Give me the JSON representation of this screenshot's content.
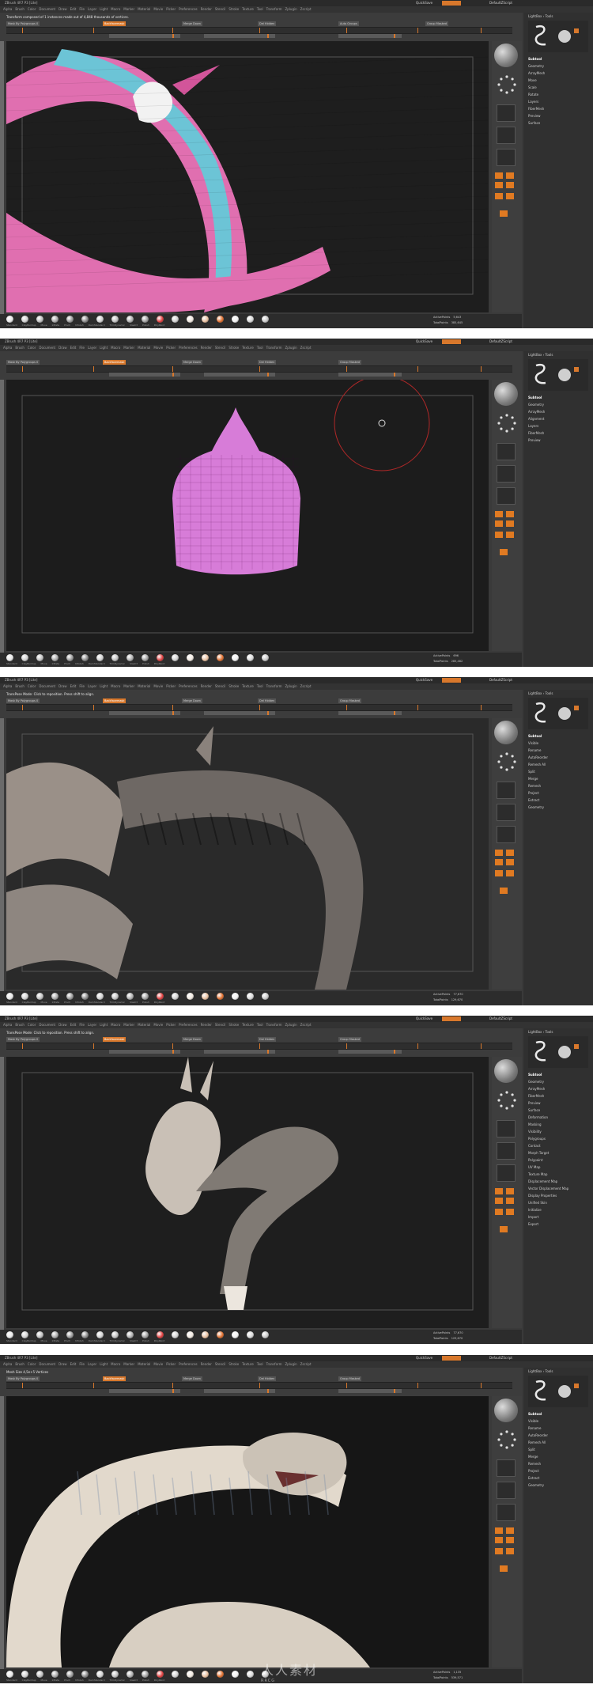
{
  "common": {
    "quicksave": "QuickSave",
    "menus": "Menus",
    "default_zscript": "DefaultZScript",
    "menubar": [
      "Alpha",
      "Brush",
      "Color",
      "Document",
      "Draw",
      "Edit",
      "File",
      "Layer",
      "Light",
      "Macro",
      "Marker",
      "Material",
      "Movie",
      "Picker",
      "Preferences",
      "Render",
      "Stencil",
      "Stroke",
      "Texture",
      "Tool",
      "Transform",
      "Zplugin",
      "Zscript"
    ],
    "active_points": "ActivePoints",
    "total_points": "TotalPoints",
    "brush_labels": [
      "Standard",
      "ClayBuildup",
      "Move",
      "Inflate",
      "Pinch",
      "hPolish",
      "DamStandard",
      "TrimDynamic",
      "Slash3",
      "Polish",
      "PolyPaint"
    ]
  },
  "panels": [
    {
      "title": "ZBrush 4R7 P3 [Lite]",
      "message": "Transform composed of 1 instances made out of 4,848 thousands of vertices.",
      "controls": [
        "Mask By Polygroups 0",
        "Auto Groups With UV",
        "Backfacemask",
        "Group Split",
        "Merge Down",
        "Split Masked Points",
        "Del Hidden",
        "Close Holes",
        "Auto Groups",
        "Front Shading",
        "Group Masked"
      ],
      "active_points": "5,643",
      "total_points": "385,645",
      "tray_items": [
        "Subtool",
        "Geometry",
        "ArrayMesh",
        "Move",
        "Scale",
        "Rotate",
        "Layers",
        "FiberMesh",
        "Preview",
        "Surface"
      ]
    },
    {
      "title": "ZBrush 4R7 P3 [Lite]",
      "message": "",
      "controls": [
        "Mask By Polygroups 0",
        "Auto Groups With UV",
        "Backfacemask",
        "Group Split",
        "Merge Down",
        "Split Masked Points",
        "Del Hidden",
        "Auto Groups",
        "Group Masked"
      ],
      "active_points": "696",
      "total_points": "285,482",
      "tray_items": [
        "Subtool",
        "Geometry",
        "ArrayMesh",
        "Alignment",
        "Layers",
        "FiberMesh",
        "Preview"
      ]
    },
    {
      "title": "ZBrush 4R7 P3 [Lite]",
      "message": "TransPose Mode: Click to reposition. Press shift to align.",
      "controls": [
        "Mask By Polygroups 0",
        "Auto Groups With UV",
        "Backfacemask",
        "Group Split",
        "Merge Down",
        "Split Masked Points",
        "Del Hidden",
        "Auto Groups",
        "Group Masked"
      ],
      "active_points": "77,670",
      "total_points": "129,670",
      "tray_items": [
        "Subtool",
        "Visible",
        "Rename",
        "AutoReorder",
        "Remesh All",
        "Split",
        "Merge",
        "Remesh",
        "Project",
        "Extract",
        "Geometry"
      ]
    },
    {
      "title": "ZBrush 4R7 P3 [Lite]",
      "message": "TransPose Mode: Click to reposition. Press shift to align.",
      "controls": [
        "Mask By Polygroups 0",
        "Auto Groups With UV",
        "Backfacemask",
        "Group Split",
        "Merge Down",
        "Split Masked Points",
        "Del Hidden",
        "Auto Groups",
        "Group Masked"
      ],
      "active_points": "77,670",
      "total_points": "129,670",
      "tray_items": [
        "Subtool",
        "Geometry",
        "ArrayMesh",
        "FiberMesh",
        "Preview",
        "Surface",
        "Deformation",
        "Masking",
        "Visibility",
        "Polygroups",
        "Contact",
        "Morph Target",
        "Polypaint",
        "UV Map",
        "Texture Map",
        "Displacement Map",
        "Vector Displacement Map",
        "Display Properties",
        "Unified Skin",
        "Initialize",
        "Import",
        "Export"
      ]
    },
    {
      "title": "ZBrush 4R7 P3 [Lite]",
      "message": "Mesh Size 4,5e+5 Vertices",
      "controls": [
        "Mask By Polygroups 0",
        "Auto Groups With UV",
        "Backfacemask",
        "Group Split",
        "Merge Down",
        "Split Masked Points",
        "Del Hidden",
        "Auto Groups",
        "Group Masked"
      ],
      "active_points": "1,135",
      "total_points": "539,571",
      "tray_items": [
        "Subtool",
        "Visible",
        "Rename",
        "AutoReorder",
        "Remesh All",
        "Split",
        "Merge",
        "Remesh",
        "Project",
        "Extract",
        "Geometry"
      ]
    }
  ],
  "watermark": "人人素材",
  "watermark_sub": "RRCG"
}
